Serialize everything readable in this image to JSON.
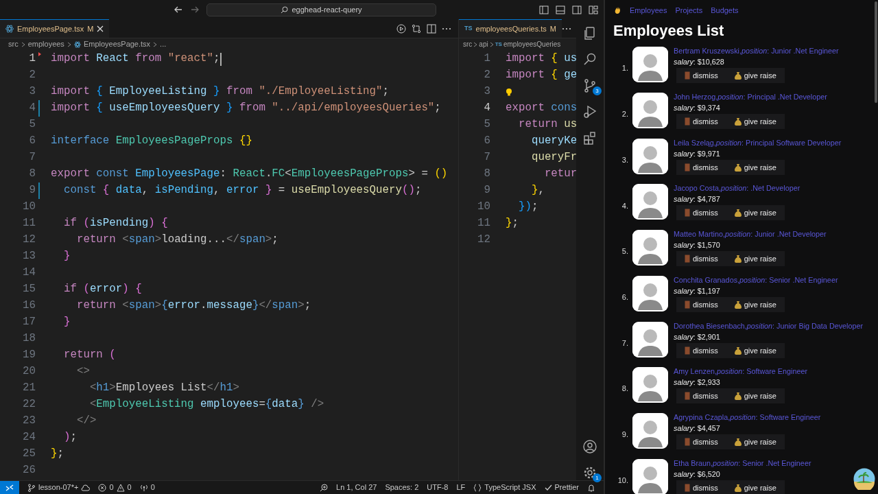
{
  "title_bar": {
    "search": "egghead-react-query"
  },
  "editors": [
    {
      "tab": {
        "label": "EmployeesPage.tsx",
        "status": "M",
        "selected": true,
        "kind": "react"
      },
      "breadcrumbs": [
        "src",
        "employees",
        "EmployeesPage.tsx",
        "..."
      ],
      "lines": [
        {
          "number": "1",
          "active": true,
          "deleted": true,
          "cursor": true,
          "tokens": [
            {
              "text": "import ",
              "kind": "keyword"
            },
            {
              "text": "React ",
              "kind": "variable"
            },
            {
              "text": "from ",
              "kind": "keyword"
            },
            {
              "text": "\"react\"",
              "kind": "string"
            },
            {
              "text": ";",
              "kind": "plain"
            }
          ]
        },
        {
          "number": "2",
          "active": false
        },
        {
          "number": "3",
          "active": false,
          "tokens": [
            {
              "text": "import ",
              "kind": "keyword"
            },
            {
              "text": "{ ",
              "kind": "brace_blue"
            },
            {
              "text": "EmployeeListing ",
              "kind": "variable"
            },
            {
              "text": "} ",
              "kind": "brace_blue"
            },
            {
              "text": "from ",
              "kind": "keyword"
            },
            {
              "text": "\"./EmployeeListing\"",
              "kind": "string"
            },
            {
              "text": ";",
              "kind": "plain"
            }
          ]
        },
        {
          "number": "4",
          "active": false,
          "modified": true,
          "tokens": [
            {
              "text": "import ",
              "kind": "keyword"
            },
            {
              "text": "{ ",
              "kind": "brace_blue"
            },
            {
              "text": "useEmployeesQuery ",
              "kind": "variable"
            },
            {
              "text": "} ",
              "kind": "brace_blue"
            },
            {
              "text": "from ",
              "kind": "keyword"
            },
            {
              "text": "\"../api/employeesQueries\"",
              "kind": "string"
            },
            {
              "text": ";",
              "kind": "plain"
            }
          ]
        },
        {
          "number": "5",
          "active": false
        },
        {
          "number": "6",
          "active": false,
          "tokens": [
            {
              "text": "interface ",
              "kind": "storage"
            },
            {
              "text": "EmployeesPageProps ",
              "kind": "type"
            },
            {
              "text": "{}",
              "kind": "brace_gold"
            }
          ]
        },
        {
          "number": "7",
          "active": false
        },
        {
          "number": "8",
          "active": false,
          "tokens": [
            {
              "text": "export ",
              "kind": "keyword"
            },
            {
              "text": "const ",
              "kind": "storage"
            },
            {
              "text": "EmployeesPage",
              "kind": "constant"
            },
            {
              "text": ": ",
              "kind": "plain"
            },
            {
              "text": "React",
              "kind": "type"
            },
            {
              "text": ".",
              "kind": "plain"
            },
            {
              "text": "FC",
              "kind": "type"
            },
            {
              "text": "<",
              "kind": "plain"
            },
            {
              "text": "EmployeesPageProps",
              "kind": "type"
            },
            {
              "text": "> = ",
              "kind": "plain"
            },
            {
              "text": "()",
              "kind": "brace_gold"
            }
          ]
        },
        {
          "number": "9",
          "active": false,
          "modified": true,
          "tokens": [
            {
              "text": "  const ",
              "kind": "storage"
            },
            {
              "text": "{ ",
              "kind": "brace_pink"
            },
            {
              "text": "data",
              "kind": "constant"
            },
            {
              "text": ", ",
              "kind": "plain"
            },
            {
              "text": "isPending",
              "kind": "constant"
            },
            {
              "text": ", ",
              "kind": "plain"
            },
            {
              "text": "error ",
              "kind": "constant"
            },
            {
              "text": "}",
              "kind": "brace_pink"
            },
            {
              "text": " = ",
              "kind": "plain"
            },
            {
              "text": "useEmployeesQuery",
              "kind": "function"
            },
            {
              "text": "()",
              "kind": "brace_pink"
            },
            {
              "text": ";",
              "kind": "plain"
            }
          ]
        },
        {
          "number": "10",
          "active": false
        },
        {
          "number": "11",
          "active": false,
          "tokens": [
            {
              "text": "  if ",
              "kind": "keyword"
            },
            {
              "text": "(",
              "kind": "brace_pink"
            },
            {
              "text": "isPending",
              "kind": "variable"
            },
            {
              "text": ") {",
              "kind": "brace_pink"
            }
          ]
        },
        {
          "number": "12",
          "active": false,
          "tokens": [
            {
              "text": "    return ",
              "kind": "keyword"
            },
            {
              "text": "<",
              "kind": "tag"
            },
            {
              "text": "span",
              "kind": "storage"
            },
            {
              "text": ">",
              "kind": "tag"
            },
            {
              "text": "loading...",
              "kind": "plain"
            },
            {
              "text": "</",
              "kind": "tag"
            },
            {
              "text": "span",
              "kind": "storage"
            },
            {
              "text": ">",
              "kind": "tag"
            },
            {
              "text": ";",
              "kind": "plain"
            }
          ]
        },
        {
          "number": "13",
          "active": false,
          "tokens": [
            {
              "text": "  }",
              "kind": "brace_pink"
            }
          ]
        },
        {
          "number": "14",
          "active": false
        },
        {
          "number": "15",
          "active": false,
          "tokens": [
            {
              "text": "  if ",
              "kind": "keyword"
            },
            {
              "text": "(",
              "kind": "brace_pink"
            },
            {
              "text": "error",
              "kind": "variable"
            },
            {
              "text": ") {",
              "kind": "brace_pink"
            }
          ]
        },
        {
          "number": "16",
          "active": false,
          "tokens": [
            {
              "text": "    return ",
              "kind": "keyword"
            },
            {
              "text": "<",
              "kind": "tag"
            },
            {
              "text": "span",
              "kind": "storage"
            },
            {
              "text": ">",
              "kind": "tag"
            },
            {
              "text": "{",
              "kind": "storage"
            },
            {
              "text": "error",
              "kind": "variable"
            },
            {
              "text": ".",
              "kind": "plain"
            },
            {
              "text": "message",
              "kind": "variable"
            },
            {
              "text": "}",
              "kind": "storage"
            },
            {
              "text": "</",
              "kind": "tag"
            },
            {
              "text": "span",
              "kind": "storage"
            },
            {
              "text": ">",
              "kind": "tag"
            },
            {
              "text": ";",
              "kind": "plain"
            }
          ]
        },
        {
          "number": "17",
          "active": false,
          "tokens": [
            {
              "text": "  }",
              "kind": "brace_pink"
            }
          ]
        },
        {
          "number": "18",
          "active": false
        },
        {
          "number": "19",
          "active": false,
          "tokens": [
            {
              "text": "  return ",
              "kind": "keyword"
            },
            {
              "text": "(",
              "kind": "brace_pink"
            }
          ]
        },
        {
          "number": "20",
          "active": false,
          "tokens": [
            {
              "text": "    <>",
              "kind": "tag"
            }
          ]
        },
        {
          "number": "21",
          "active": false,
          "tokens": [
            {
              "text": "      <",
              "kind": "tag"
            },
            {
              "text": "h1",
              "kind": "storage"
            },
            {
              "text": ">",
              "kind": "tag"
            },
            {
              "text": "Employees List",
              "kind": "plain"
            },
            {
              "text": "</",
              "kind": "tag"
            },
            {
              "text": "h1",
              "kind": "storage"
            },
            {
              "text": ">",
              "kind": "tag"
            }
          ]
        },
        {
          "number": "22",
          "active": false,
          "tokens": [
            {
              "text": "      <",
              "kind": "tag"
            },
            {
              "text": "EmployeeListing ",
              "kind": "type"
            },
            {
              "text": "employees",
              "kind": "variable"
            },
            {
              "text": "=",
              "kind": "plain"
            },
            {
              "text": "{",
              "kind": "storage"
            },
            {
              "text": "data",
              "kind": "variable"
            },
            {
              "text": "}",
              "kind": "storage"
            },
            {
              "text": " />",
              "kind": "tag"
            }
          ]
        },
        {
          "number": "23",
          "active": false,
          "tokens": [
            {
              "text": "    </>",
              "kind": "tag"
            }
          ]
        },
        {
          "number": "24",
          "active": false,
          "tokens": [
            {
              "text": "  )",
              "kind": "brace_pink"
            },
            {
              "text": ";",
              "kind": "plain"
            }
          ]
        },
        {
          "number": "25",
          "active": false,
          "tokens": [
            {
              "text": "}",
              "kind": "brace_gold"
            },
            {
              "text": ";",
              "kind": "plain"
            }
          ]
        },
        {
          "number": "26",
          "active": false
        }
      ]
    },
    {
      "tab": {
        "label": "employeesQueries.ts",
        "status": "M",
        "selected": true,
        "kind": "ts",
        "icon_text": "TS"
      },
      "breadcrumbs": [
        "src",
        "api",
        "employeesQueries"
      ],
      "breadcrumb_icon_text": "TS",
      "lines": [
        {
          "number": "1",
          "active": false,
          "tokens": [
            {
              "text": "import ",
              "kind": "keyword"
            },
            {
              "text": "{ ",
              "kind": "brace_gold"
            },
            {
              "text": "us",
              "kind": "variable"
            }
          ]
        },
        {
          "number": "2",
          "active": false,
          "tokens": [
            {
              "text": "import ",
              "kind": "keyword"
            },
            {
              "text": "{ ",
              "kind": "brace_gold"
            },
            {
              "text": "ge",
              "kind": "variable"
            }
          ]
        },
        {
          "number": "3",
          "active": false,
          "lightbulb": true
        },
        {
          "number": "4",
          "active": true,
          "tokens": [
            {
              "text": "export ",
              "kind": "keyword"
            },
            {
              "text": "cons",
              "kind": "storage"
            }
          ]
        },
        {
          "number": "5",
          "active": false,
          "tokens": [
            {
              "text": "  return ",
              "kind": "keyword"
            },
            {
              "text": "us",
              "kind": "function"
            }
          ]
        },
        {
          "number": "6",
          "active": false,
          "tokens": [
            {
              "text": "    queryKe",
              "kind": "variable"
            }
          ]
        },
        {
          "number": "7",
          "active": false,
          "tokens": [
            {
              "text": "    queryFr",
              "kind": "function"
            }
          ]
        },
        {
          "number": "8",
          "active": false,
          "tokens": [
            {
              "text": "      retur",
              "kind": "keyword"
            }
          ]
        },
        {
          "number": "9",
          "active": false,
          "tokens": [
            {
              "text": "    }",
              "kind": "brace_gold"
            },
            {
              "text": ",",
              "kind": "plain"
            }
          ]
        },
        {
          "number": "10",
          "active": false,
          "tokens": [
            {
              "text": "  })",
              "kind": "brace_blue"
            },
            {
              "text": ";",
              "kind": "plain"
            }
          ]
        },
        {
          "number": "11",
          "active": false,
          "tokens": [
            {
              "text": "}",
              "kind": "brace_gold"
            },
            {
              "text": ";",
              "kind": "plain"
            }
          ]
        },
        {
          "number": "12",
          "active": false
        }
      ]
    }
  ],
  "activity_bar": [
    {
      "kind": "explorer"
    },
    {
      "kind": "search"
    },
    {
      "kind": "source_control",
      "badge": "3"
    },
    {
      "kind": "debug"
    },
    {
      "kind": "extensions"
    },
    {
      "kind": "account"
    },
    {
      "kind": "settings",
      "badge": "1"
    }
  ],
  "status_bar": {
    "branch": "lesson-07*+",
    "errors": "0",
    "warnings": "0",
    "ports": "0",
    "position": "Ln 1, Col 27",
    "indent": "Spaces: 2",
    "encoding": "UTF-8",
    "eol": "LF",
    "language": "TypeScript JSX",
    "formatter": "Prettier"
  },
  "browser": {
    "nav": [
      "Employees",
      "Projects",
      "Budgets"
    ],
    "heading": "Employees List",
    "employees": [
      {
        "number": "1.",
        "title": "Bertram Kruszewski,*position*: Junior .Net Engineer",
        "salary": "*salary*: $10,628",
        "buttons": [
          "dismiss",
          "give raise"
        ]
      },
      {
        "number": "2.",
        "title": "John Herzog,*position*: Principal .Net Developer",
        "salary": "*salary*: $9,374",
        "buttons": [
          "dismiss",
          "give raise"
        ]
      },
      {
        "number": "3.",
        "title": "Leila Szeląg,*position*: Principal Software Developer",
        "salary": "*salary*: $9,971",
        "buttons": [
          "dismiss",
          "give raise"
        ]
      },
      {
        "number": "4.",
        "title": "Jacopo Costa,*position*: .Net Developer",
        "salary": "*salary*: $4,787",
        "buttons": [
          "dismiss",
          "give raise"
        ]
      },
      {
        "number": "5.",
        "title": "Matteo Martino,*position*: Junior .Net Developer",
        "salary": "*salary*: $1,570",
        "buttons": [
          "dismiss",
          "give raise"
        ]
      },
      {
        "number": "6.",
        "title": "Conchita Granados,*position*: Senior .Net Engineer",
        "salary": "*salary*: $1,197",
        "buttons": [
          "dismiss",
          "give raise"
        ]
      },
      {
        "number": "7.",
        "title": "Dorothea Biesenbach,*position*: Junior Big Data Developer",
        "salary": "*salary*: $2,901",
        "buttons": [
          "dismiss",
          "give raise"
        ]
      },
      {
        "number": "8.",
        "title": "Amy Lenzen,*position*: Software Engineer",
        "salary": "*salary*: $2,933",
        "buttons": [
          "dismiss",
          "give raise"
        ]
      },
      {
        "number": "9.",
        "title": "Agrypina Czapla,*position*: Software Engineer",
        "salary": "*salary*: $4,457",
        "buttons": [
          "dismiss",
          "give raise"
        ]
      },
      {
        "number": "10.",
        "title": "Etha Braun,*position*: Senior .Net Engineer",
        "salary": "*salary*: $6,520",
        "buttons": [
          "dismiss",
          "give raise"
        ]
      }
    ]
  }
}
